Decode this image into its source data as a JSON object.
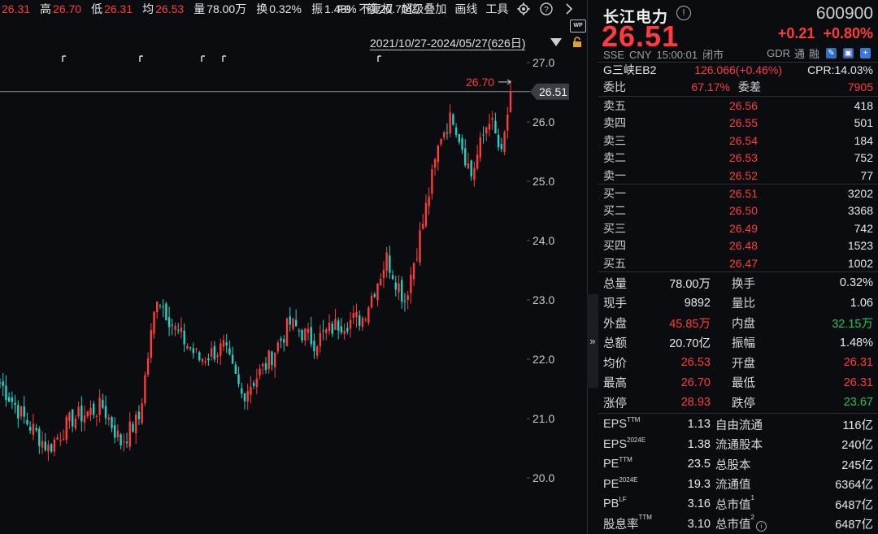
{
  "topbar": {
    "items": [
      {
        "label": "",
        "value": "26.31",
        "color": "red"
      },
      {
        "label": "高",
        "value": "26.70",
        "color": "red"
      },
      {
        "label": "低",
        "value": "26.31",
        "color": "red"
      },
      {
        "label": "均",
        "value": "26.53",
        "color": "red"
      },
      {
        "label": "量",
        "value": "78.00万",
        "color": "white"
      },
      {
        "label": "换",
        "value": "0.32%",
        "color": "white"
      },
      {
        "label": "振",
        "value": "1.48%",
        "color": "white"
      },
      {
        "label": "额",
        "value": "20.70亿",
        "color": "white"
      }
    ],
    "tools": [
      "F9",
      "不复权",
      "超级叠加",
      "画线",
      "工具"
    ],
    "gear_icon": "gear-icon",
    "help_icon": "help-icon",
    "next_icon": "chevron-right-icon"
  },
  "range": {
    "text": "2021/10/27-2024/05/27(626日)",
    "wp_label": "WP"
  },
  "chart_data": {
    "type": "candlestick",
    "y_ticks": [
      27.0,
      26.0,
      25.0,
      24.0,
      23.0,
      22.0,
      21.0,
      20.0
    ],
    "y_tick_labels": [
      "27.0",
      "26.0",
      "25.0",
      "24.0",
      "23.0",
      "22.0",
      "21.0",
      "20.0"
    ],
    "ylim": [
      19.9,
      27.2
    ],
    "current_price": 26.51,
    "current_price_label": "26.51",
    "high_annotation": "26.70",
    "high_value": 26.7,
    "up_color": "#ff3b3b",
    "down_color": "#1fd3c6",
    "n_candles": 170,
    "waypoints": [
      [
        0,
        21.6
      ],
      [
        8,
        21.0
      ],
      [
        16,
        20.5
      ],
      [
        24,
        21.0
      ],
      [
        34,
        21.2
      ],
      [
        40,
        20.6
      ],
      [
        46,
        21.0
      ],
      [
        52,
        23.1
      ],
      [
        58,
        22.5
      ],
      [
        66,
        22.0
      ],
      [
        74,
        22.2
      ],
      [
        80,
        21.4
      ],
      [
        88,
        21.9
      ],
      [
        96,
        22.6
      ],
      [
        104,
        22.3
      ],
      [
        112,
        22.6
      ],
      [
        120,
        22.7
      ],
      [
        128,
        23.7
      ],
      [
        134,
        23.0
      ],
      [
        140,
        24.3
      ],
      [
        146,
        25.8
      ],
      [
        150,
        26.1
      ],
      [
        156,
        25.1
      ],
      [
        162,
        26.1
      ],
      [
        166,
        25.4
      ],
      [
        169,
        26.51
      ]
    ]
  },
  "quote": {
    "name": "长江电力",
    "code": "600900",
    "price": "26.51",
    "change": "+0.21",
    "change_pct": "+0.80%",
    "meta": [
      "SSE",
      "CNY",
      "15:00:01",
      "闭市"
    ],
    "gdr": [
      "GDR",
      "通",
      "融"
    ],
    "bond": {
      "name": "G三峡EB2",
      "value": "126.066(+0.46%)",
      "cpr": "CPR:14.03%"
    },
    "wei": {
      "label1": "委比",
      "value1": "67.17%",
      "label2": "委差",
      "value2": "7905"
    },
    "asks": [
      {
        "label": "卖五",
        "price": "26.56",
        "vol": "418"
      },
      {
        "label": "卖四",
        "price": "26.55",
        "vol": "501"
      },
      {
        "label": "卖三",
        "price": "26.54",
        "vol": "184"
      },
      {
        "label": "卖二",
        "price": "26.53",
        "vol": "752"
      },
      {
        "label": "卖一",
        "price": "26.52",
        "vol": "77"
      }
    ],
    "bids": [
      {
        "label": "买一",
        "price": "26.51",
        "vol": "3202"
      },
      {
        "label": "买二",
        "price": "26.50",
        "vol": "3368"
      },
      {
        "label": "买三",
        "price": "26.49",
        "vol": "742"
      },
      {
        "label": "买四",
        "price": "26.48",
        "vol": "1523"
      },
      {
        "label": "买五",
        "price": "26.47",
        "vol": "1002"
      }
    ],
    "stats": [
      {
        "a": "总量",
        "b": "78.00万",
        "bc": "white",
        "c": "换手",
        "d": "0.32%",
        "dc": "white"
      },
      {
        "a": "现手",
        "b": "9892",
        "bc": "white",
        "c": "量比",
        "d": "1.06",
        "dc": "white"
      },
      {
        "a": "外盘",
        "b": "45.85万",
        "bc": "red",
        "c": "内盘",
        "d": "32.15万",
        "dc": "green"
      },
      {
        "a": "总额",
        "b": "20.70亿",
        "bc": "white",
        "c": "振幅",
        "d": "1.48%",
        "dc": "white"
      },
      {
        "a": "均价",
        "b": "26.53",
        "bc": "red",
        "c": "开盘",
        "d": "26.31",
        "dc": "red"
      },
      {
        "a": "最高",
        "b": "26.70",
        "bc": "red",
        "c": "最低",
        "d": "26.31",
        "dc": "red"
      },
      {
        "a": "涨停",
        "b": "28.93",
        "bc": "red",
        "c": "跌停",
        "d": "23.67",
        "dc": "green"
      }
    ],
    "fundamentals": [
      {
        "a": "EPS",
        "sup": "TTM",
        "b": "1.13",
        "c": "自由流通",
        "csup": "",
        "d": "116亿"
      },
      {
        "a": "EPS",
        "sup": "2024E",
        "b": "1.38",
        "c": "流通股本",
        "csup": "",
        "d": "240亿"
      },
      {
        "a": "PE",
        "sup": "TTM",
        "b": "23.5",
        "c": "总股本",
        "csup": "",
        "d": "245亿"
      },
      {
        "a": "PE",
        "sup": "2024E",
        "b": "19.3",
        "c": "流通值",
        "csup": "",
        "d": "6364亿"
      },
      {
        "a": "PB",
        "sup": "LF",
        "b": "3.16",
        "c": "总市值",
        "csup": "1",
        "d": "6487亿"
      },
      {
        "a": "股息率",
        "sup": "TTM",
        "b": "3.10",
        "c": "总市值",
        "csup": "2",
        "d": "6487亿"
      }
    ]
  }
}
